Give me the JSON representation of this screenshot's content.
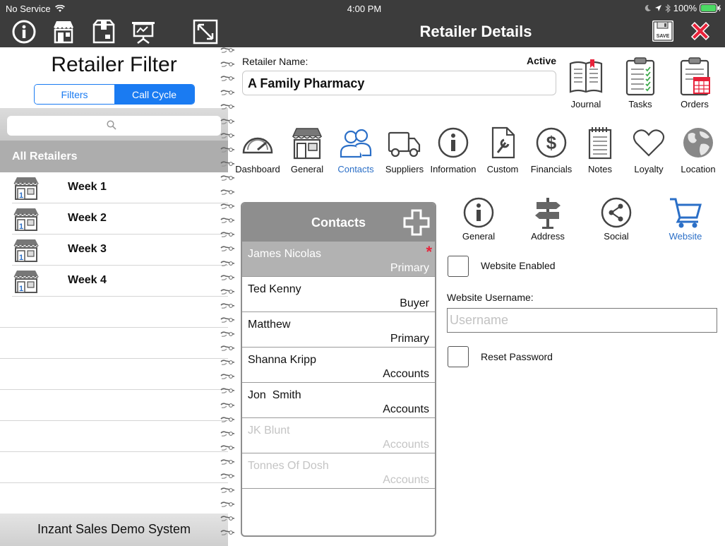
{
  "status_bar": {
    "carrier": "No Service",
    "time": "4:00 PM",
    "battery": "100%"
  },
  "left_toolbar": {
    "icons": [
      "info-icon",
      "retailer-store-icon",
      "package-icon",
      "presentation-icon",
      "expand-icon"
    ]
  },
  "retailer_filter": {
    "title": "Retailer Filter",
    "segments": [
      "Filters",
      "Call Cycle"
    ],
    "selected_segment": "Call Cycle",
    "search_placeholder": "",
    "group_header": "All Retailers",
    "weeks": [
      "Week 1",
      "Week 2",
      "Week 3",
      "Week 4"
    ],
    "footer": "Inzant Sales Demo System"
  },
  "header": {
    "title": "Retailer Details",
    "save_label": "SAVE"
  },
  "retailer": {
    "name_label": "Retailer Name:",
    "name_value": "A Family Pharmacy",
    "status": "Active"
  },
  "top_tools": [
    "Journal",
    "Tasks",
    "Orders"
  ],
  "nav_tabs": {
    "items": [
      "Dashboard",
      "General",
      "Contacts",
      "Suppliers",
      "Information",
      "Custom",
      "Financials",
      "Notes",
      "Loyalty",
      "Location"
    ],
    "selected": "Contacts"
  },
  "contacts": {
    "title": "Contacts",
    "items": [
      {
        "name": "James Nicolas",
        "role": "Primary",
        "selected": true,
        "star": "*"
      },
      {
        "name": "Ted Kenny",
        "role": "Buyer"
      },
      {
        "name": "Matthew",
        "role": "Primary"
      },
      {
        "name": "Shanna Kripp",
        "role": "Accounts"
      },
      {
        "name": "Jon  Smith",
        "role": "Accounts"
      },
      {
        "name": "JK Blunt",
        "role": "Accounts",
        "inactive": true
      },
      {
        "name": "Tonnes Of Dosh",
        "role": "Accounts",
        "inactive": true
      }
    ]
  },
  "contact_tabs": {
    "items": [
      "General",
      "Address",
      "Social",
      "Website"
    ],
    "selected": "Website"
  },
  "website": {
    "enabled_label": "Website Enabled",
    "enabled": false,
    "username_label": "Website Username:",
    "username_value": "",
    "username_placeholder": "Username",
    "reset_label": "Reset Password",
    "reset": false
  },
  "colors": {
    "toolbar_bg": "#3c3c3c",
    "accent_blue": "#1a7bf2",
    "selected_tab_blue": "#2b6fc7",
    "contacts_header": "#8e8e8e",
    "close_red": "#e8223a"
  }
}
